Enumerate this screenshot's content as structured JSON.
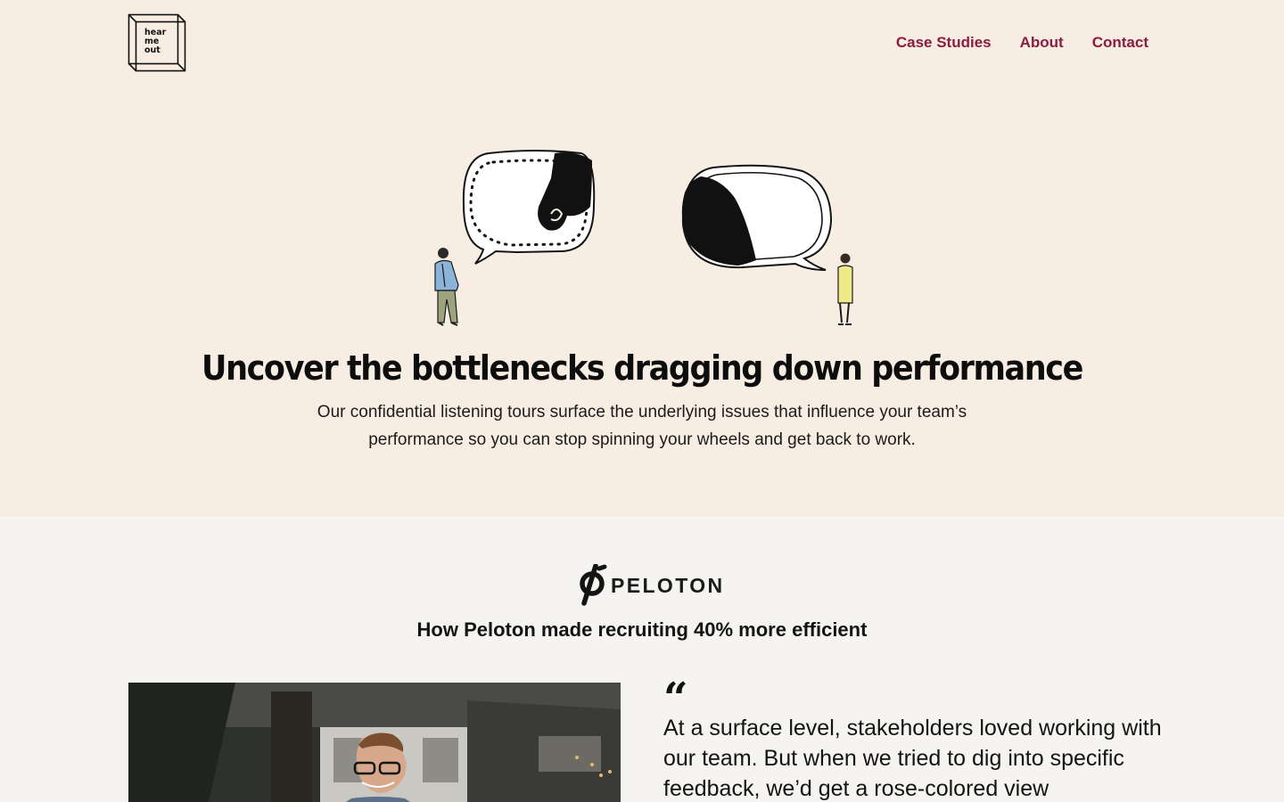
{
  "logo": {
    "lines": [
      "hear",
      "me",
      "out"
    ]
  },
  "nav": {
    "items": [
      {
        "label": "Case Studies"
      },
      {
        "label": "About"
      },
      {
        "label": "Contact"
      }
    ]
  },
  "hero": {
    "headline": "Uncover the bottlenecks dragging down performance",
    "subtext": "Our confidential listening tours surface the underlying issues that influence your team’s performance so you can stop spinning your wheels and get back to work."
  },
  "case_study": {
    "brand": "PELOTON",
    "title": "How Peloton made recruiting 40% more efficient",
    "quote_mark": "“",
    "quote": "At a surface level, stakeholders loved working with our team. But when we tried to dig into specific feedback, we’d get a rose-colored view"
  },
  "colors": {
    "hero_bg": "#f7ede2",
    "page_bg": "#f6f4f0",
    "nav_link": "#8a1c40",
    "text": "#141414"
  }
}
